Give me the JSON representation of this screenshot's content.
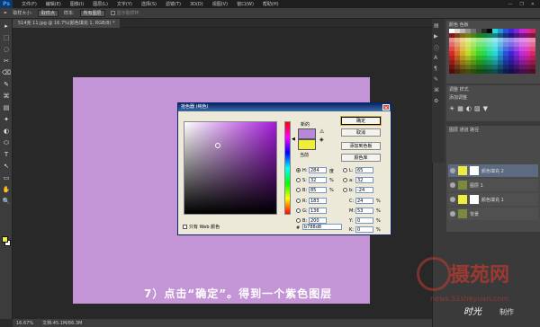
{
  "app": {
    "logo": "Ps",
    "menu": [
      "文件(F)",
      "编辑(E)",
      "图像(I)",
      "图层(L)",
      "文字(Y)",
      "选择(S)",
      "滤镜(T)",
      "3D(D)",
      "视图(V)",
      "窗口(W)",
      "帮助(H)"
    ],
    "win_controls": [
      "—",
      "❐",
      "✕"
    ]
  },
  "options": {
    "tool_icon": "✒",
    "size_label": "取样大小:",
    "size_value": "取样点",
    "sample_label": "样本:",
    "sample_value": "所有图层",
    "show_ring": "显示取样环"
  },
  "document": {
    "tab": "514克 11.jpg @ 16.7%(颜色填充 1, RGB/8) *",
    "canvas_color": "#c394d6"
  },
  "status": {
    "zoom": "16.67%",
    "doc": "文档:45.1M/86.3M"
  },
  "tools": [
    "▸",
    "⬚",
    "◌",
    "✂",
    "⌫",
    "✎",
    "⌘",
    "▤",
    "✦",
    "◐",
    "⬭",
    "T",
    "↖",
    "▭",
    "✋",
    "🔍"
  ],
  "colors": {
    "foreground": "#f0ec3c",
    "background": "#ffffff"
  },
  "dialog": {
    "title": "拾色器 (纯色)",
    "close": "✕",
    "new_label": "新的",
    "current_label": "当前",
    "new_color": "#b788d8",
    "current_color": "#f0ec3c",
    "buttons": {
      "ok": "确定",
      "cancel": "取消",
      "add_swatch": "添加到色板",
      "libraries": "颜色库"
    },
    "fields": {
      "H": {
        "label": "H:",
        "value": "284",
        "unit": "度"
      },
      "S": {
        "label": "S:",
        "value": "32",
        "unit": "%"
      },
      "B": {
        "label": "B:",
        "value": "85",
        "unit": "%"
      },
      "R": {
        "label": "R:",
        "value": "183",
        "unit": ""
      },
      "G": {
        "label": "G:",
        "value": "136",
        "unit": ""
      },
      "Bl": {
        "label": "B:",
        "value": "200",
        "unit": ""
      },
      "L": {
        "label": "L:",
        "value": "65",
        "unit": ""
      },
      "a": {
        "label": "a:",
        "value": "32",
        "unit": ""
      },
      "b": {
        "label": "b:",
        "value": "-24",
        "unit": ""
      },
      "C": {
        "label": "C:",
        "value": "24",
        "unit": "%"
      },
      "M": {
        "label": "M:",
        "value": "53",
        "unit": "%"
      },
      "Y": {
        "label": "Y:",
        "value": "0",
        "unit": "%"
      },
      "K": {
        "label": "K:",
        "value": "0",
        "unit": "%"
      }
    },
    "web_only": "只有 Web 颜色",
    "hex_label": "#",
    "hex": "b788d8"
  },
  "panels": {
    "swatches_tabs": "颜色  色板",
    "adjust_tabs": "调整  样式",
    "adjust_add": "添加调整",
    "layers_tabs": "图层  通道  路径",
    "layers": [
      {
        "name": "颜色填充 2",
        "thumb": "#f0ec3c",
        "selected": true
      },
      {
        "name": "图层 1",
        "thumb": "#7a8a3a",
        "selected": false
      },
      {
        "name": "颜色填充 1",
        "thumb": "#f0ec3c",
        "selected": false
      },
      {
        "name": "背景",
        "thumb": "#7a8a3a",
        "selected": false
      }
    ]
  },
  "caption": "7）点击“确定”。得到一个紫色图层",
  "watermark": {
    "text": "摄苑网",
    "url": "news.51sheyuan.com"
  },
  "signature": {
    "name": "时光",
    "suffix": "制作"
  }
}
